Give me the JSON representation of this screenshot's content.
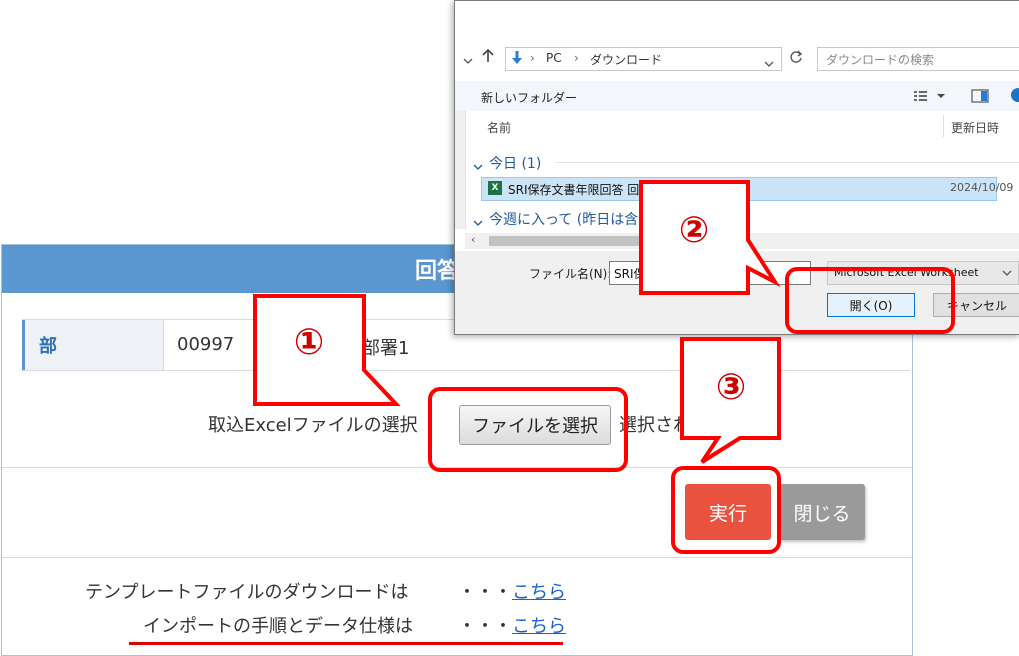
{
  "main_dialog": {
    "title": "回答",
    "department": {
      "label": "部",
      "code": "00997",
      "name": "部署1"
    },
    "file_select": {
      "label": "取込Excelファイルの選択",
      "button_label": "ファイルを選択",
      "status_text": "選択され"
    },
    "buttons": {
      "execute": "実行",
      "close": "閉じる"
    },
    "links": {
      "template_text": "テンプレートファイルのダウンロードは",
      "template_dots": "・・・",
      "template_link": "こちら",
      "import_text": "インポートの手順とデータ仕様は",
      "import_dots": "・・・",
      "import_link": "こちら"
    }
  },
  "file_dialog": {
    "breadcrumb": [
      "PC",
      "ダウンロード"
    ],
    "search_placeholder": "ダウンロードの検索",
    "new_folder": "新しいフォルダー",
    "columns": {
      "name": "名前",
      "date": "更新日時"
    },
    "groups": {
      "today": "今日 (1)",
      "this_week": "今週に入って (昨日は含"
    },
    "file": {
      "name": "SRI保存文書年限回答 回",
      "date": "2024/10/09"
    },
    "filename_label": "ファイル名(N):",
    "filename_value": "SRI保",
    "filetype_value": "Microsoft Excel Worksheet",
    "open_button": "開く(O)",
    "cancel_button": "キャンセル"
  },
  "callouts": {
    "step1": "①",
    "step2": "②",
    "step3": "③"
  },
  "colors": {
    "header_blue": "#5a96cf",
    "execute_red": "#e8523f",
    "highlight_red": "#ff0000",
    "link_blue": "#1a5fd0"
  }
}
